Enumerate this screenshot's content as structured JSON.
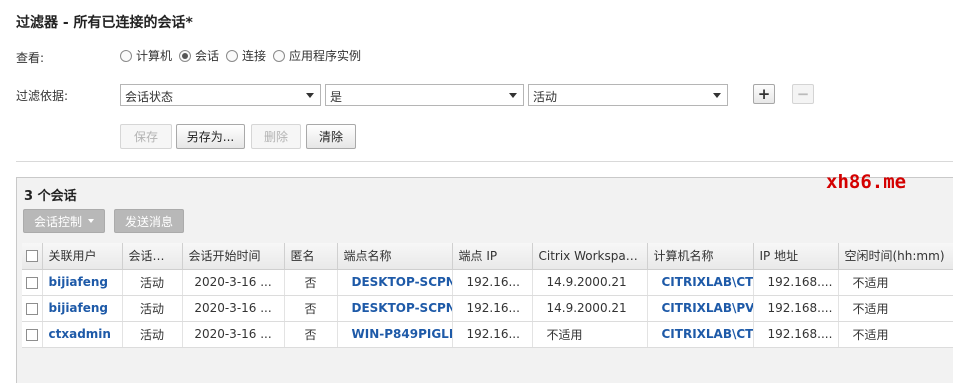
{
  "title": "过滤器 - 所有已连接的会话*",
  "view": {
    "label": "查看:",
    "options": [
      {
        "label": "计算机",
        "checked": false
      },
      {
        "label": "会话",
        "checked": true
      },
      {
        "label": "连接",
        "checked": false
      },
      {
        "label": "应用程序实例",
        "checked": false
      }
    ]
  },
  "filter": {
    "label": "过滤依据:",
    "field": "会话状态",
    "operator": "是",
    "value": "活动",
    "add_symbol": "+",
    "remove_symbol": "−"
  },
  "actions": {
    "save": "保存",
    "save_as": "另存为...",
    "delete": "删除",
    "clear": "清除"
  },
  "watermark": "xh86.me",
  "sessions": {
    "count_label": "3 个会话",
    "session_control": "会话控制",
    "send_message": "发送消息",
    "columns": [
      "关联用户",
      "会话状...",
      "会话开始时间",
      "匿名",
      "端点名称",
      "端点 IP",
      "Citrix Workspac...",
      "计算机名称",
      "IP 地址",
      "空闲时间(hh:mm)"
    ],
    "rows": [
      [
        "bijiafeng",
        "活动",
        "2020-3-16 ...",
        "否",
        "DESKTOP-SCPN",
        "192.16...",
        "14.9.2000.21",
        "CITRIXLAB\\CT",
        "192.168....",
        "不适用"
      ],
      [
        "bijiafeng",
        "活动",
        "2020-3-16 ...",
        "否",
        "DESKTOP-SCPN",
        "192.16...",
        "14.9.2000.21",
        "CITRIXLAB\\PV",
        "192.168....",
        "不适用"
      ],
      [
        "ctxadmin",
        "活动",
        "2020-3-16 ...",
        "否",
        "WIN-P849PIGLI",
        "192.16...",
        "不适用",
        "CITRIXLAB\\CT",
        "192.168....",
        "不适用"
      ]
    ]
  }
}
